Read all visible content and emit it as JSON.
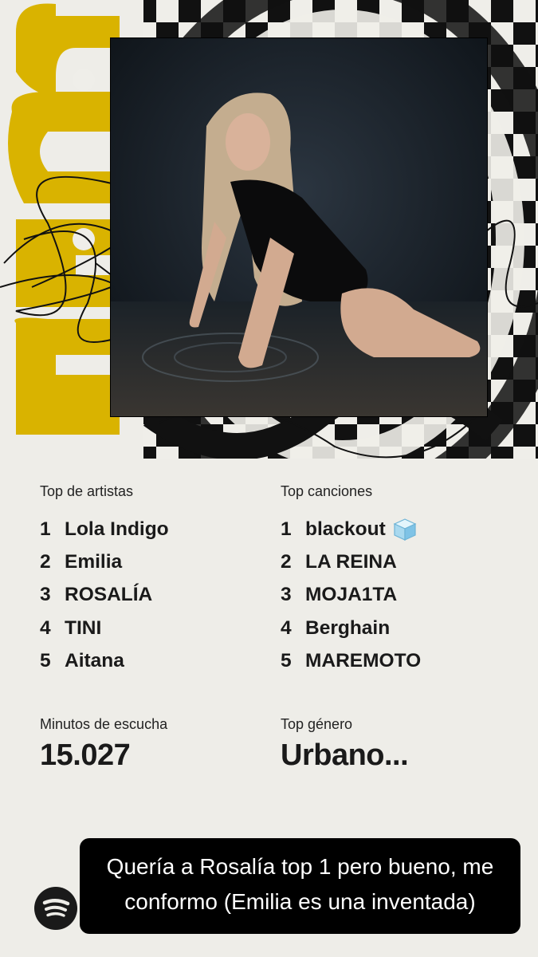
{
  "hero": {
    "year_text": "2025",
    "accent_color": "#d9b300",
    "photo_alt": "album cover"
  },
  "top_artists": {
    "heading": "Top de artistas",
    "items": [
      {
        "rank": "1",
        "name": "Lola Indigo"
      },
      {
        "rank": "2",
        "name": "Emilia"
      },
      {
        "rank": "3",
        "name": "ROSALÍA"
      },
      {
        "rank": "4",
        "name": "TINI"
      },
      {
        "rank": "5",
        "name": "Aitana"
      }
    ]
  },
  "top_songs": {
    "heading": "Top canciones",
    "items": [
      {
        "rank": "1",
        "name": "blackout",
        "icon": "ice-cube-icon"
      },
      {
        "rank": "2",
        "name": "LA REINA"
      },
      {
        "rank": "3",
        "name": "MOJA1TA"
      },
      {
        "rank": "4",
        "name": "Berghain"
      },
      {
        "rank": "5",
        "name": "MAREMOTO"
      }
    ]
  },
  "stats": {
    "minutes_label": "Minutos de escucha",
    "minutes_value": "15.027",
    "genre_label": "Top género",
    "genre_value": "Urbano..."
  },
  "caption": {
    "line1": "Quería a Rosalía top 1 pero bueno, me",
    "line2": "conformo (Emilia es una inventada)"
  },
  "brand": {
    "icon": "spotify-logo-icon"
  }
}
